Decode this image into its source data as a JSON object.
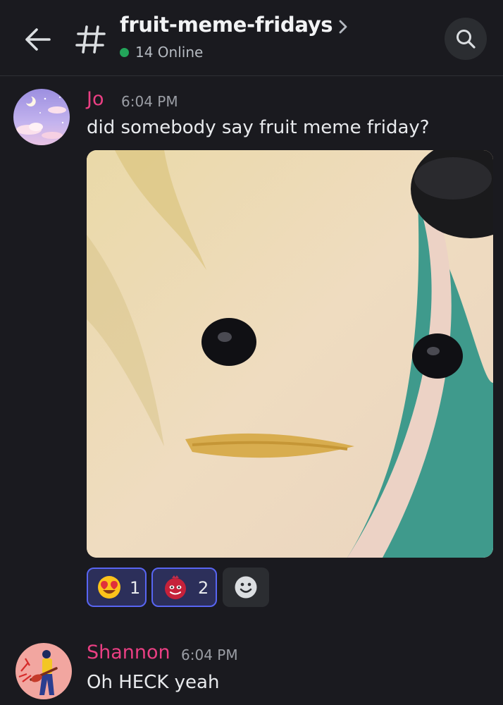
{
  "header": {
    "channel_name": "fruit-meme-fridays",
    "online_count": "14 Online"
  },
  "messages": [
    {
      "author": "Jo",
      "timestamp": "6:04 PM",
      "text": "did somebody say fruit meme friday?",
      "attachment": "banana-with-face-image",
      "reactions": [
        {
          "emoji": "heart-eyes-emoji",
          "count": "1"
        },
        {
          "emoji": "pomegranate-emoji",
          "count": "2"
        }
      ]
    },
    {
      "author": "Shannon",
      "timestamp": "6:04 PM",
      "text": "Oh HECK yeah"
    }
  ],
  "colors": {
    "background": "#1a1a1f",
    "author_name": "#ea3f83",
    "online_indicator": "#23a55a",
    "reaction_active_border": "#5865f2"
  }
}
